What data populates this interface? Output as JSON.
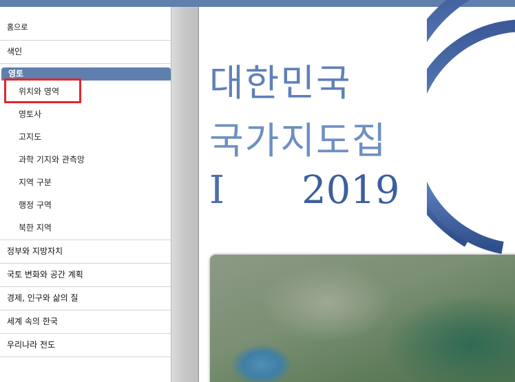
{
  "sidebar": {
    "home": "홈으로",
    "index": "색인",
    "active_section": "영토",
    "sub_items": [
      "위치와 영역",
      "영토사",
      "고지도",
      "과학 기지와 관측망",
      "지역 구분",
      "행정 구역",
      "북한 지역"
    ],
    "sections": [
      "정부와 지방자치",
      "국토 변화와 공간 계획",
      "경제, 인구와 삶의 질",
      "세계 속의 한국",
      "우리나라 전도"
    ]
  },
  "document": {
    "title_line1": "대한민국",
    "title_line2": "국가지도집",
    "volume": "I",
    "year": "2019"
  },
  "colors": {
    "accent": "#5f7fae",
    "highlight": "#e0262c"
  }
}
